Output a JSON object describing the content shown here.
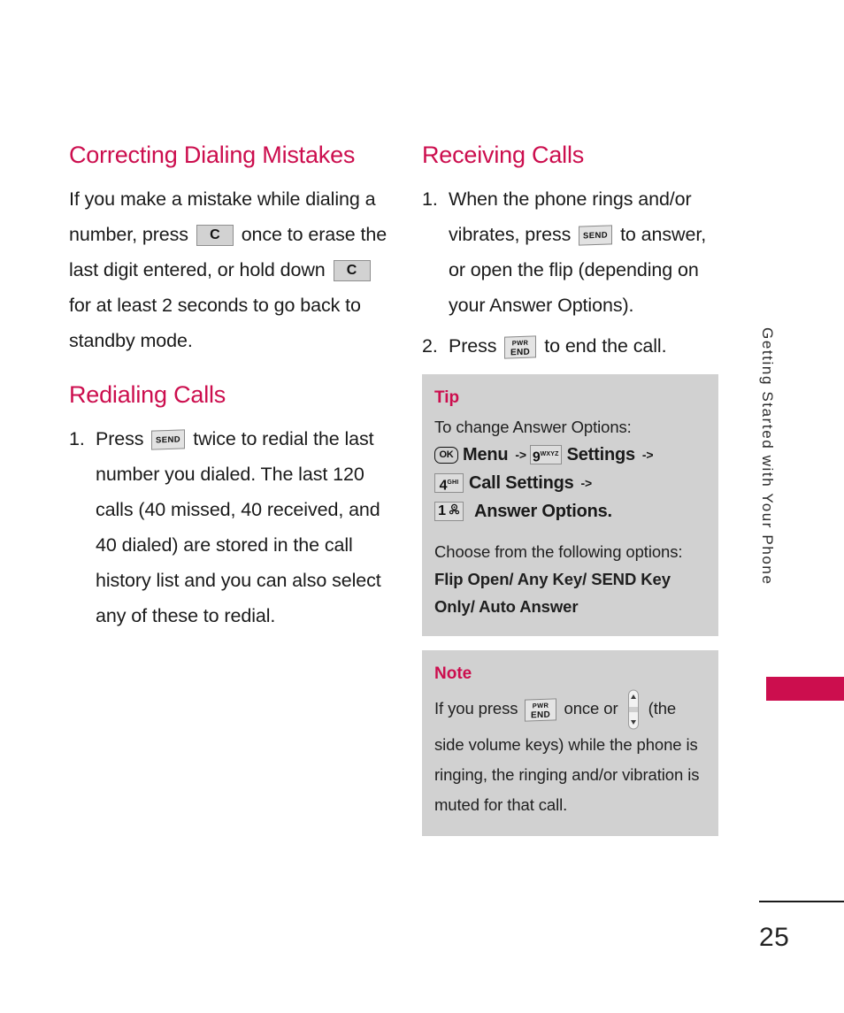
{
  "document": {
    "page_number": "25",
    "side_tab_label": "Getting Started with Your Phone",
    "accent_color": "#cc0e4e",
    "callout_bg": "#d1d1d1"
  },
  "left_column": {
    "section1": {
      "title": "Correcting Dialing Mistakes",
      "text_part1": "If you make a mistake while dialing a number, press",
      "key1": "C",
      "text_part2": "once to erase the last digit entered, or hold down",
      "key2": "C",
      "text_part3": "for at least 2 seconds to go back to standby mode."
    },
    "section2": {
      "title": "Redialing Calls",
      "steps": [
        {
          "number": "1.",
          "text_part1": "Press",
          "key": "SEND",
          "text_part2": "twice to redial the last number you dialed. The last 120 calls (40 missed, 40 received, and 40 dialed) are stored in the call history list and you can also select any of these to redial."
        }
      ]
    }
  },
  "right_column": {
    "section1": {
      "title": "Receiving Calls",
      "steps": [
        {
          "number": "1.",
          "text_part1": "When the phone rings and/or vibrates, press",
          "key": "SEND",
          "text_part2": "to answer, or open the flip (depending on your Answer Options)."
        },
        {
          "number": "2.",
          "text_part1": "Press",
          "key_line1": "PWR",
          "key_line2": "END",
          "text_part2": "to end the call."
        }
      ]
    },
    "tip_box": {
      "heading": "Tip",
      "intro": "To change Answer Options:",
      "path": [
        {
          "key_label": "OK",
          "key_sup": "",
          "label": "Menu",
          "arrow": "->"
        },
        {
          "key_label": "9",
          "key_sup": "WXYZ",
          "label": "Settings",
          "arrow": "->"
        },
        {
          "key_label": "4",
          "key_sup": "GHI",
          "label": "Call Settings",
          "arrow": "->"
        },
        {
          "key_label": "1",
          "key_sup": "voicemail-icon",
          "label": "Answer Options.",
          "arrow": ""
        }
      ],
      "options_intro": "Choose from the following options:",
      "options_bold_line1": "Flip Open/ Any Key/ SEND Key",
      "options_bold_line2": "Only/ Auto Answer"
    },
    "note_box": {
      "heading": "Note",
      "text_part1": "If you press",
      "key_line1": "PWR",
      "key_line2": "END",
      "text_part2": "once or",
      "volume_icon": "volume-rocker-icon",
      "text_part3": "(the side volume keys) while the phone is ringing, the ringing and/or vibration is muted for that call."
    }
  }
}
